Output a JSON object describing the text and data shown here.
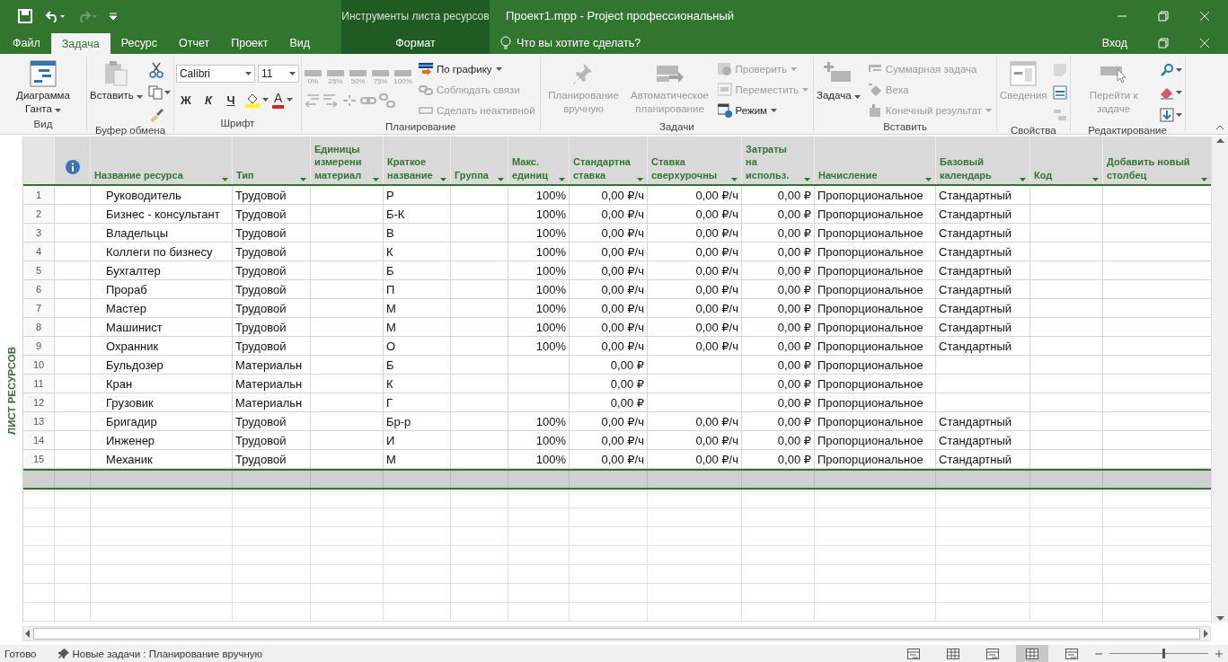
{
  "title_bar": {
    "context_title": "Инструменты листа ресурсов",
    "title": "Проект1.mpp - Project профессиональный"
  },
  "tabs": [
    {
      "label": "Файл",
      "selected": false,
      "kind": "normal"
    },
    {
      "label": "Задача",
      "selected": true,
      "kind": "normal"
    },
    {
      "label": "Ресурс",
      "selected": false,
      "kind": "normal"
    },
    {
      "label": "Отчет",
      "selected": false,
      "kind": "normal"
    },
    {
      "label": "Проект",
      "selected": false,
      "kind": "normal"
    },
    {
      "label": "Вид",
      "selected": false,
      "kind": "normal"
    },
    {
      "label": "Формат",
      "selected": false,
      "kind": "context"
    }
  ],
  "tell_me": {
    "placeholder": "Что вы хотите сделать?"
  },
  "sign_in": "Вход",
  "ribbon": {
    "groups": [
      {
        "label": "Вид",
        "columns": [
          {
            "kind": "large",
            "label": "Диаграмма Ганта",
            "dropdown": true,
            "disabled": false
          }
        ]
      },
      {
        "label": "Буфер обмена",
        "columns": [
          {
            "kind": "large",
            "label": "Вставить",
            "dropdown": true,
            "disabled": false
          },
          {
            "kind": "icons"
          }
        ]
      },
      {
        "label": "Шрифт",
        "columns": [
          {
            "kind": "font",
            "font": "Calibri",
            "size": "11",
            "styles": [
              "Ж",
              "К",
              "Ч"
            ],
            "font_color": "A"
          }
        ]
      },
      {
        "label": "Планирование",
        "columns": [
          {
            "kind": "percent",
            "labels": [
              "0%",
              "25%",
              "50%",
              "75%",
              "100%"
            ],
            "disabled": true
          },
          {
            "kind": "stack",
            "items": [
              {
                "label": "По графику",
                "dropdown": true,
                "disabled": false
              },
              {
                "label": "Соблюдать связи",
                "dropdown": false,
                "disabled": true
              },
              {
                "label": "Сделать неактивной",
                "dropdown": false,
                "disabled": true
              }
            ]
          }
        ]
      },
      {
        "label": "Задачи",
        "columns": [
          {
            "kind": "large",
            "label": "Планирование вручную",
            "dropdown": false,
            "disabled": true
          },
          {
            "kind": "large",
            "label": "Автоматическое планирование",
            "dropdown": false,
            "disabled": true
          },
          {
            "kind": "stack",
            "items": [
              {
                "label": "Проверить",
                "dropdown": true,
                "disabled": true
              },
              {
                "label": "Переместить",
                "dropdown": true,
                "disabled": true
              },
              {
                "label": "Режим",
                "dropdown": true,
                "disabled": false
              }
            ]
          }
        ]
      },
      {
        "label": "Вставить",
        "columns": [
          {
            "kind": "large",
            "label": "Задача",
            "dropdown": true,
            "disabled": false
          },
          {
            "kind": "stack",
            "items": [
              {
                "label": "Суммарная задача",
                "dropdown": false,
                "disabled": true
              },
              {
                "label": "Веха",
                "dropdown": false,
                "disabled": true
              },
              {
                "label": "Конечный результат",
                "dropdown": true,
                "disabled": true
              }
            ]
          }
        ]
      },
      {
        "label": "Свойства",
        "columns": [
          {
            "kind": "large",
            "label": "Сведения",
            "dropdown": false,
            "disabled": true
          },
          {
            "kind": "icons"
          }
        ]
      },
      {
        "label": "Редактирование",
        "columns": [
          {
            "kind": "large",
            "label": "Перейти к задаче",
            "dropdown": false,
            "disabled": true
          },
          {
            "kind": "icons"
          }
        ]
      }
    ]
  },
  "side_label": "ЛИСТ РЕСУРСОВ",
  "table": {
    "columns": [
      {
        "kind": "info"
      },
      {
        "kind": "text",
        "label": "Название ресурса"
      },
      {
        "kind": "text",
        "label": "Тип"
      },
      {
        "kind": "text",
        "label": "Единицы\nизмерени\nматериал"
      },
      {
        "kind": "text",
        "label": "Краткое\nназвание"
      },
      {
        "kind": "text",
        "label": "Группа"
      },
      {
        "kind": "number",
        "label": "Макс.\nединиц"
      },
      {
        "kind": "number",
        "label": "Стандартна\nставка"
      },
      {
        "kind": "number",
        "label": "Ставка\nсверхурочны"
      },
      {
        "kind": "number",
        "label": "Затраты\nна\nиспольз."
      },
      {
        "kind": "text",
        "label": "Начисление"
      },
      {
        "kind": "text",
        "label": "Базовый\nкалендарь"
      },
      {
        "kind": "text",
        "label": "Код"
      },
      {
        "kind": "text",
        "label": "Добавить новый\nстолбец"
      }
    ],
    "rows": [
      {
        "number": "1",
        "name": "Руководитель",
        "type": "Трудовой",
        "initials": "Р",
        "max_units": "100%",
        "std_rate": "0,00 ₽/ч",
        "ovt_rate": "0,00 ₽/ч",
        "cost_per_use": "0,00 ₽",
        "accrue": "Пропорциональное",
        "base_calendar": "Стандартный"
      },
      {
        "number": "2",
        "name": "Бизнес - консультант",
        "type": "Трудовой",
        "initials": "Б-К",
        "max_units": "100%",
        "std_rate": "0,00 ₽/ч",
        "ovt_rate": "0,00 ₽/ч",
        "cost_per_use": "0,00 ₽",
        "accrue": "Пропорциональное",
        "base_calendar": "Стандартный"
      },
      {
        "number": "3",
        "name": "Владельцы",
        "type": "Трудовой",
        "initials": "В",
        "max_units": "100%",
        "std_rate": "0,00 ₽/ч",
        "ovt_rate": "0,00 ₽/ч",
        "cost_per_use": "0,00 ₽",
        "accrue": "Пропорциональное",
        "base_calendar": "Стандартный"
      },
      {
        "number": "4",
        "name": "Коллеги по бизнесу",
        "type": "Трудовой",
        "initials": "К",
        "max_units": "100%",
        "std_rate": "0,00 ₽/ч",
        "ovt_rate": "0,00 ₽/ч",
        "cost_per_use": "0,00 ₽",
        "accrue": "Пропорциональное",
        "base_calendar": "Стандартный"
      },
      {
        "number": "5",
        "name": "Бухгалтер",
        "type": "Трудовой",
        "initials": "Б",
        "max_units": "100%",
        "std_rate": "0,00 ₽/ч",
        "ovt_rate": "0,00 ₽/ч",
        "cost_per_use": "0,00 ₽",
        "accrue": "Пропорциональное",
        "base_calendar": "Стандартный"
      },
      {
        "number": "6",
        "name": "Прораб",
        "type": "Трудовой",
        "initials": "П",
        "max_units": "100%",
        "std_rate": "0,00 ₽/ч",
        "ovt_rate": "0,00 ₽/ч",
        "cost_per_use": "0,00 ₽",
        "accrue": "Пропорциональное",
        "base_calendar": "Стандартный"
      },
      {
        "number": "7",
        "name": "Мастер",
        "type": "Трудовой",
        "initials": "М",
        "max_units": "100%",
        "std_rate": "0,00 ₽/ч",
        "ovt_rate": "0,00 ₽/ч",
        "cost_per_use": "0,00 ₽",
        "accrue": "Пропорциональное",
        "base_calendar": "Стандартный"
      },
      {
        "number": "8",
        "name": "Машинист",
        "type": "Трудовой",
        "initials": "М",
        "max_units": "100%",
        "std_rate": "0,00 ₽/ч",
        "ovt_rate": "0,00 ₽/ч",
        "cost_per_use": "0,00 ₽",
        "accrue": "Пропорциональное",
        "base_calendar": "Стандартный"
      },
      {
        "number": "9",
        "name": "Охранник",
        "type": "Трудовой",
        "initials": "О",
        "max_units": "100%",
        "std_rate": "0,00 ₽/ч",
        "ovt_rate": "0,00 ₽/ч",
        "cost_per_use": "0,00 ₽",
        "accrue": "Пропорциональное",
        "base_calendar": "Стандартный"
      },
      {
        "number": "10",
        "name": "Бульдозер",
        "type": "Материальн",
        "initials": "Б",
        "std_rate": "0,00 ₽",
        "cost_per_use": "0,00 ₽",
        "accrue": "Пропорциональное"
      },
      {
        "number": "11",
        "name": "Кран",
        "type": "Материальн",
        "initials": "К",
        "std_rate": "0,00 ₽",
        "cost_per_use": "0,00 ₽",
        "accrue": "Пропорциональное"
      },
      {
        "number": "12",
        "name": "Грузовик",
        "type": "Материальн",
        "initials": "Г",
        "std_rate": "0,00 ₽",
        "cost_per_use": "0,00 ₽",
        "accrue": "Пропорциональное"
      },
      {
        "number": "13",
        "name": "Бригадир",
        "type": "Трудовой",
        "initials": "Бр-р",
        "max_units": "100%",
        "std_rate": "0,00 ₽/ч",
        "ovt_rate": "0,00 ₽/ч",
        "cost_per_use": "0,00 ₽",
        "accrue": "Пропорциональное",
        "base_calendar": "Стандартный"
      },
      {
        "number": "14",
        "name": "Инженер",
        "type": "Трудовой",
        "initials": "И",
        "max_units": "100%",
        "std_rate": "0,00 ₽/ч",
        "ovt_rate": "0,00 ₽/ч",
        "cost_per_use": "0,00 ₽",
        "accrue": "Пропорциональное",
        "base_calendar": "Стандартный"
      },
      {
        "number": "15",
        "name": "Механик",
        "type": "Трудовой",
        "initials": "М",
        "max_units": "100%",
        "std_rate": "0,00 ₽/ч",
        "ovt_rate": "0,00 ₽/ч",
        "cost_per_use": "0,00 ₽",
        "accrue": "Пропорциональное",
        "base_calendar": "Стандартный"
      }
    ],
    "entry_row": {
      "selected": true
    }
  },
  "status_bar": {
    "status": "Готово",
    "new_tasks": "Новые задачи : Планирование вручную",
    "views": [
      {
        "selected": false
      },
      {
        "selected": false
      },
      {
        "selected": false
      },
      {
        "selected": true
      },
      {
        "selected": false
      }
    ],
    "zoom": {
      "level": 0.55
    }
  }
}
